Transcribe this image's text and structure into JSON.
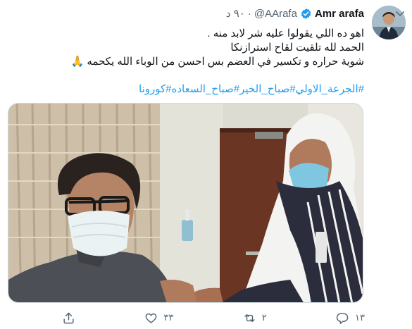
{
  "tweet": {
    "display_name": "Amr arafa",
    "handle": "@AArafa",
    "separator": "·",
    "time": "٩٠ د",
    "lines": [
      "اهو ده اللي يقولوا عليه  شر لابد منه .",
      "الحمد لله تلقيت لقاح  استرازنكا",
      "شوية حراره و تكسير في العضم بس احسن من الوباء الله يكحمه 🙏"
    ],
    "hashtags": [
      "#الجرعة_الاولي",
      "#صباح_الخير",
      "#صباح_السعاده",
      "#كورونا"
    ]
  },
  "actions": {
    "reply_count": "١٣",
    "retweet_count": "٢",
    "like_count": "٣٣"
  },
  "colors": {
    "link": "#1d9bf0",
    "muted": "#536471",
    "verified": "#1d9bf0"
  },
  "icons": {
    "verified": "verified-badge-icon",
    "caret": "chevron-down-icon",
    "reply": "reply-icon",
    "retweet": "retweet-icon",
    "like": "heart-icon",
    "share": "share-icon"
  }
}
